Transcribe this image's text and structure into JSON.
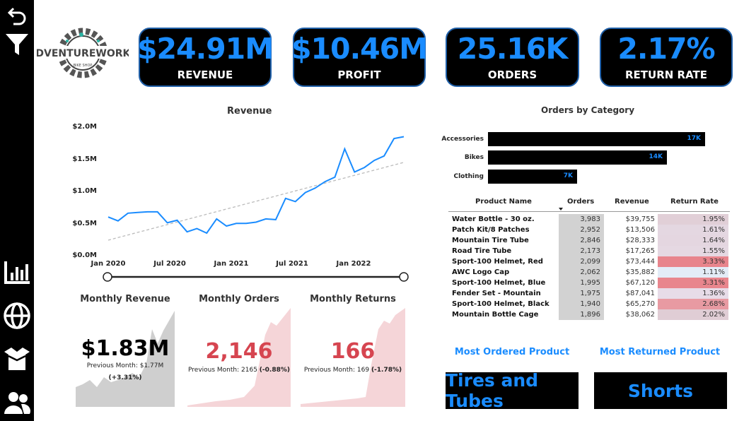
{
  "nav": {
    "icons": [
      "back-icon",
      "filter-icon",
      "bar-chart-icon",
      "globe-icon",
      "box-icon",
      "people-icon"
    ]
  },
  "logo": {
    "text": "ADVENTUREWORKS",
    "subtext": "BIKE SHOP"
  },
  "kpis": [
    {
      "value": "$24.91M",
      "label": "REVENUE"
    },
    {
      "value": "$10.46M",
      "label": "PROFIT"
    },
    {
      "value": "25.16K",
      "label": "ORDERS"
    },
    {
      "value": "2.17%",
      "label": "RETURN RATE"
    }
  ],
  "revenue_chart": {
    "title": "Revenue",
    "y_ticks": [
      "$2.0M",
      "$1.5M",
      "$1.0M",
      "$0.5M",
      "$0.0M"
    ],
    "x_ticks": [
      "Jan 2020",
      "Jul 2020",
      "Jan 2021",
      "Jul 2021",
      "Jan 2022"
    ]
  },
  "chart_data": {
    "type": "line",
    "title": "Revenue",
    "x": [
      "2020-01",
      "2020-02",
      "2020-03",
      "2020-04",
      "2020-05",
      "2020-06",
      "2020-07",
      "2020-08",
      "2020-09",
      "2020-10",
      "2020-11",
      "2020-12",
      "2021-01",
      "2021-02",
      "2021-03",
      "2021-04",
      "2021-05",
      "2021-06",
      "2021-07",
      "2021-08",
      "2021-09",
      "2021-10",
      "2021-11",
      "2021-12",
      "2022-01",
      "2022-02",
      "2022-03",
      "2022-04",
      "2022-05",
      "2022-06"
    ],
    "series": [
      {
        "values": [
          0.58,
          0.52,
          0.64,
          0.65,
          0.66,
          0.66,
          0.49,
          0.53,
          0.35,
          0.4,
          0.33,
          0.55,
          0.44,
          0.48,
          0.48,
          0.5,
          0.55,
          0.54,
          0.87,
          0.82,
          0.96,
          1.03,
          1.13,
          1.2,
          1.64,
          1.28,
          1.35,
          1.46,
          1.53,
          1.8,
          1.83
        ]
      }
    ],
    "trend": {
      "style": "dashed",
      "start": 0.22,
      "end": 1.43
    },
    "ylim": [
      0,
      2.0
    ],
    "y_unit": "$M",
    "grid": false
  },
  "monthly": {
    "revenue": {
      "title": "Monthly Revenue",
      "value": "$1.83M",
      "previous": "Previous Month: $1.77M",
      "change": "(+3.31%)"
    },
    "orders": {
      "title": "Monthly Orders",
      "value": "2,146",
      "previous_prefix": "Previous Month: 2165",
      "change": "(-0.88%)"
    },
    "returns": {
      "title": "Monthly Returns",
      "value": "166",
      "previous_prefix": "Previous Month: 169",
      "change": "(-1.78%)"
    }
  },
  "orders_by_category": {
    "title": "Orders by Category",
    "items": [
      {
        "category": "Accessories",
        "value": 17000,
        "label": "17K"
      },
      {
        "category": "Bikes",
        "value": 14000,
        "label": "14K"
      },
      {
        "category": "Clothing",
        "value": 7000,
        "label": "7K"
      }
    ],
    "max": 17000
  },
  "product_table": {
    "headers": [
      "Product Name",
      "Orders",
      "Revenue",
      "Return Rate"
    ],
    "rows": [
      {
        "name": "Water Bottle - 30 oz.",
        "orders": "3,983",
        "revenue": "$39,755",
        "return_rate": "1.95%",
        "rr": 1.95
      },
      {
        "name": "Patch Kit/8 Patches",
        "orders": "2,952",
        "revenue": "$13,506",
        "return_rate": "1.61%",
        "rr": 1.61
      },
      {
        "name": "Mountain Tire Tube",
        "orders": "2,846",
        "revenue": "$28,333",
        "return_rate": "1.64%",
        "rr": 1.64
      },
      {
        "name": "Road Tire Tube",
        "orders": "2,173",
        "revenue": "$17,265",
        "return_rate": "1.55%",
        "rr": 1.55
      },
      {
        "name": "Sport-100 Helmet, Red",
        "orders": "2,099",
        "revenue": "$73,444",
        "return_rate": "3.33%",
        "rr": 3.33
      },
      {
        "name": "AWC Logo Cap",
        "orders": "2,062",
        "revenue": "$35,882",
        "return_rate": "1.11%",
        "rr": 1.11
      },
      {
        "name": "Sport-100 Helmet, Blue",
        "orders": "1,995",
        "revenue": "$67,120",
        "return_rate": "3.31%",
        "rr": 3.31
      },
      {
        "name": "Fender Set - Mountain",
        "orders": "1,975",
        "revenue": "$87,041",
        "return_rate": "1.36%",
        "rr": 1.36
      },
      {
        "name": "Sport-100 Helmet, Black",
        "orders": "1,940",
        "revenue": "$65,270",
        "return_rate": "2.68%",
        "rr": 2.68
      },
      {
        "name": "Mountain Bottle Cage",
        "orders": "1,896",
        "revenue": "$38,062",
        "return_rate": "2.02%",
        "rr": 2.02
      }
    ]
  },
  "most_ordered": {
    "label": "Most Ordered Product",
    "value": "Tires and Tubes"
  },
  "most_returned": {
    "label": "Most Returned Product",
    "value": "Shorts"
  },
  "colors": {
    "accent": "#1a8cff",
    "negative": "#d64550",
    "rail": "#000000",
    "grey_area": "#cfcfcf",
    "pink_area": "#f5d5d8"
  }
}
